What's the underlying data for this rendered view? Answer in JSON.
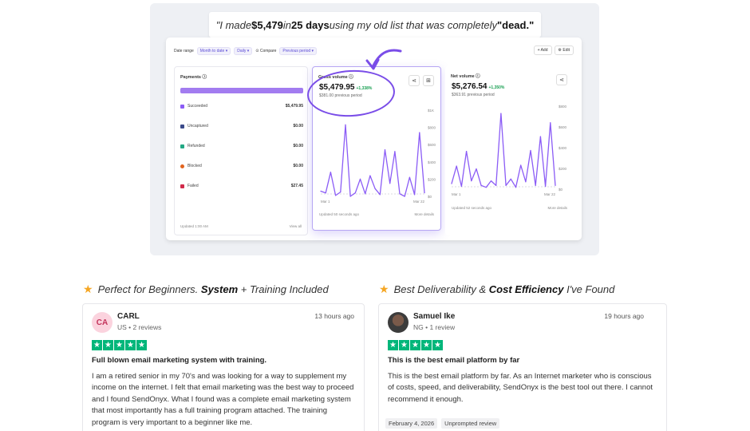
{
  "hero": {
    "quote_pre": "\"I made ",
    "quote_amount": "$5,479",
    "quote_mid1": " in ",
    "quote_days": "25 days",
    "quote_mid2": " using my old list that was completely ",
    "quote_dead": "\"dead.\""
  },
  "dashboard": {
    "toolbar": {
      "date_range_label": "Date range",
      "date_range_value": "Month to date ▾",
      "interval_value": "Daily ▾",
      "compare_label": "Compare",
      "compare_value": "Previous period ▾",
      "add_label": "+ Add",
      "edit_label": "Edit"
    },
    "payments": {
      "title": "Payments ⓘ",
      "rows": [
        {
          "label": "Succeeded",
          "value": "$5,479.95",
          "color": "#8b5cf6"
        },
        {
          "label": "Uncaptured",
          "value": "$0.00",
          "color": "#3b4a8a"
        },
        {
          "label": "Refunded",
          "value": "$0.00",
          "color": "#22a884"
        },
        {
          "label": "Blocked",
          "value": "$0.00",
          "color": "#e2641f"
        },
        {
          "label": "Failed",
          "value": "$27.45",
          "color": "#d12a4a"
        }
      ],
      "updated": "Updated 1:00 AM",
      "view_all": "View all"
    },
    "gross": {
      "title": "Gross volume ⓘ",
      "value": "$5,479.95",
      "change": "+1,338%",
      "previous": "$381.00 previous period",
      "y_ticks": [
        "$1K",
        "$800",
        "$600",
        "$400",
        "$200",
        "$0"
      ],
      "x_start": "Mar 1",
      "x_end": "Mar 22",
      "updated": "Updated 50 seconds ago",
      "more": "More details"
    },
    "net": {
      "title": "Net volume ⓘ",
      "value": "$5,276.54",
      "change": "+1,350%",
      "previous": "$363.91 previous period",
      "y_ticks": [
        "$800",
        "$600",
        "$400",
        "$200",
        "$0"
      ],
      "x_start": "Mar 1",
      "x_end": "Mar 22",
      "updated": "Updated 52 seconds ago",
      "more": "More details"
    }
  },
  "reviews": [
    {
      "heading_pre": "Perfect for Beginners. ",
      "heading_bold": "System",
      "heading_post": " + Training Included",
      "initials": "CA",
      "name": "CARL",
      "meta": "US • 2 reviews",
      "time": "13 hours ago",
      "title": "Full blown email marketing system with training.",
      "body": "I am a retired senior in my 70's and was looking for a way to supplement my income on the internet. I felt that email marketing was the best way to proceed and I found SendOnyx. What I found was a complete email marketing system that most importantly has a full training program attached. The training program is very important to a beginner like me."
    },
    {
      "heading_pre": "Best Deliverability & ",
      "heading_bold": "Cost Efficiency",
      "heading_post": " I've Found",
      "name": "Samuel Ike",
      "meta": "NG • 1 review",
      "time": "19 hours ago",
      "title": "This is the best email platform by far",
      "body": "This is the best email platform by far. As an Internet marketer who is conscious of costs, speed, and deliverability, SendOnyx is the best tool out there. I cannot recommend it enough.",
      "tags": [
        "February 4, 2026",
        "Unprompted review"
      ]
    }
  ],
  "chart_data": [
    {
      "type": "line",
      "title": "Gross volume",
      "ylim": [
        0,
        1000
      ],
      "x_range": [
        "Mar 1",
        "Mar 22"
      ],
      "series": [
        {
          "values": [
            60,
            40,
            280,
            10,
            50,
            830,
            0,
            40,
            200,
            30,
            240,
            90,
            20,
            540,
            150,
            520,
            30,
            0,
            220,
            20,
            740,
            40
          ]
        }
      ]
    },
    {
      "type": "line",
      "title": "Net volume",
      "ylim": [
        0,
        900
      ],
      "x_range": [
        "Mar 1",
        "Mar 22"
      ],
      "series": [
        {
          "values": [
            60,
            250,
            30,
            410,
            90,
            220,
            40,
            20,
            90,
            40,
            820,
            40,
            110,
            20,
            260,
            80,
            420,
            40,
            570,
            30,
            720,
            40
          ]
        }
      ]
    }
  ]
}
